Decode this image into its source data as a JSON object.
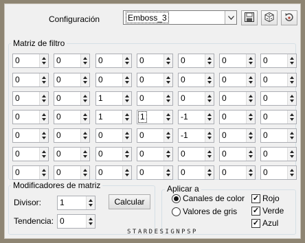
{
  "header": {
    "config_label": "Configuración",
    "preset_value": "Emboss_3"
  },
  "icons": {
    "dropdown": "chevron-down-icon",
    "save": "floppy-disk-icon",
    "random": "dice-icon",
    "reset": "reset-icon"
  },
  "matrix": {
    "title": "Matriz de filtro",
    "rows": [
      [
        "0",
        "0",
        "0",
        "0",
        "0",
        "0",
        "0"
      ],
      [
        "0",
        "0",
        "0",
        "0",
        "0",
        "0",
        "0"
      ],
      [
        "0",
        "0",
        "1",
        "0",
        "0",
        "0",
        "0"
      ],
      [
        "0",
        "0",
        "1",
        "1",
        "-1",
        "0",
        "0"
      ],
      [
        "0",
        "0",
        "0",
        "0",
        "-1",
        "0",
        "0"
      ],
      [
        "0",
        "0",
        "0",
        "0",
        "0",
        "0",
        "0"
      ],
      [
        "0",
        "0",
        "0",
        "0",
        "0",
        "0",
        "0"
      ]
    ],
    "focused_cell": [
      3,
      3
    ]
  },
  "modifiers": {
    "title": "Modificadores de matriz",
    "divisor_label": "Divisor:",
    "divisor_value": "1",
    "bias_label": "Tendencia:",
    "bias_value": "0",
    "calc_button": "Calcular"
  },
  "apply": {
    "title": "Aplicar a",
    "radio_color": "Canales de color",
    "radio_gray": "Valores de gris",
    "selected": "color",
    "check_red": "Rojo",
    "check_green": "Verde",
    "check_blue": "Azul",
    "red_checked": true,
    "green_checked": true,
    "blue_checked": true
  },
  "watermark": "STARDESIGNPSP",
  "colors": {
    "frame": "#8e8573",
    "dialog": "#f0f0f0",
    "group_border": "#d5dfe5"
  }
}
